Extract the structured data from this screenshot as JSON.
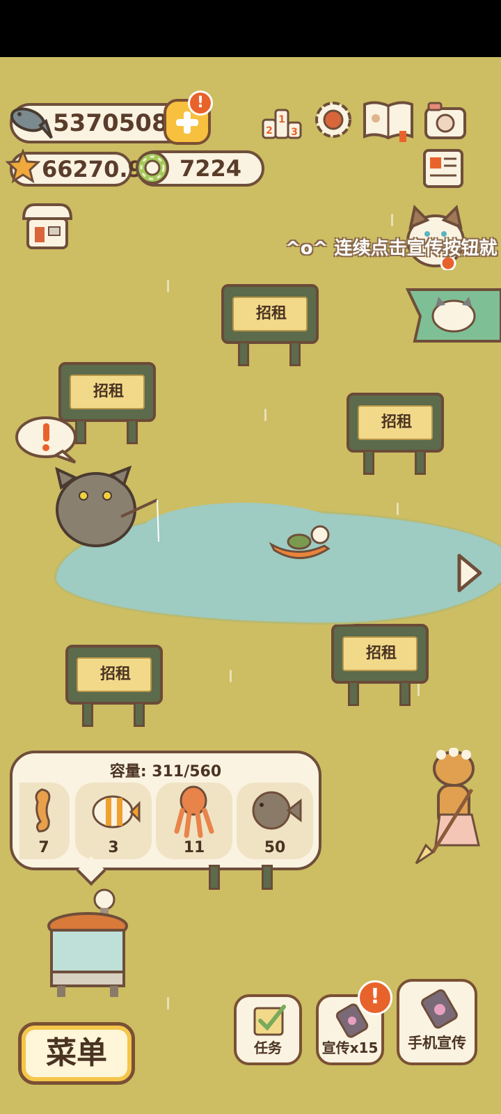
{
  "currencies": {
    "fish": "5370508",
    "star": "66270.9",
    "ring": "7224"
  },
  "marquee_text": "^o^ 连续点击宣传按钮就",
  "plots": [
    {
      "label": "招租"
    },
    {
      "label": "招租"
    },
    {
      "label": "招租"
    },
    {
      "label": "招租"
    },
    {
      "label": "招租"
    }
  ],
  "alert_symbol": "!",
  "storage": {
    "capacity_text": "容量: 311/560",
    "items": [
      {
        "icon": "seahorse-icon",
        "count": "7"
      },
      {
        "icon": "butterflyfish-icon",
        "count": "3"
      },
      {
        "icon": "squid-icon",
        "count": "11"
      },
      {
        "icon": "pufferfish-icon",
        "count": "50"
      }
    ]
  },
  "bottom_bar": {
    "menu_label": "菜单",
    "tasks_label": "任务",
    "promote_label": "宣传x15",
    "phone_promote_label": "手机宣传"
  },
  "colors": {
    "field": "#cdbd63",
    "pond": "#9ecbc2",
    "accent_orange": "#e8632c",
    "button_yellow": "#f7c03e"
  }
}
